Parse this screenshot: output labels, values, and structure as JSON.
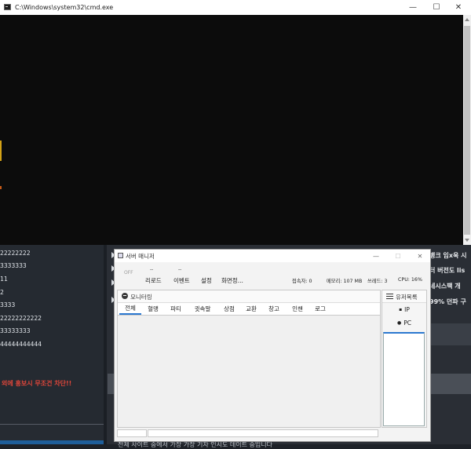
{
  "cmd": {
    "title": "C:\\Windows\\system32\\cmd.exe",
    "minimize_glyph": "—",
    "maximize_glyph": "☐",
    "close_glyph": "✕"
  },
  "background": {
    "left_lines": [
      "22222222",
      "3333333",
      "11",
      "2",
      "3333",
      "22222222222",
      "33333333",
      "44444444444"
    ],
    "warning_text": "외에 홍보시 무조건 차단!!",
    "news": [
      "뱅크 임x욱 시",
      "터 버전도 lis",
      "네시스팩 개",
      "99% 던파 구"
    ],
    "bottom_text": "전체 사이트 중에서 가장 가장 기자 인시도 데이트 중입니다"
  },
  "server_manager": {
    "title": "서버 매니저",
    "toolbar": {
      "off_label": "OFF",
      "dash1": "--",
      "dash2": "--",
      "buttons": [
        "리로드",
        "이벤트",
        "설정",
        "화면정..."
      ],
      "stats": {
        "connected": "접속자: 0",
        "memory": "메모리: 107 MB",
        "threads": "쓰레드: 3",
        "cpu": "CPU: 16%"
      }
    },
    "monitor": {
      "title": "모니터링",
      "tabs": [
        "전체",
        "혈맹",
        "파티",
        "귓속말",
        "상점",
        "교환",
        "창고",
        "인챈",
        "로그"
      ],
      "active_tab": "전체"
    },
    "users": {
      "title": "유저목록",
      "items": [
        "IP",
        "PC"
      ]
    }
  },
  "colors": {
    "accent": "#2b78d0",
    "warning": "#e0463a",
    "cmd_background": "#0c0c0c"
  },
  "icons": {
    "cmd_app": "console-icon",
    "monitor": "monitor-icon",
    "users": "list-icon",
    "ip": "plug-icon",
    "pc": "person-icon"
  }
}
